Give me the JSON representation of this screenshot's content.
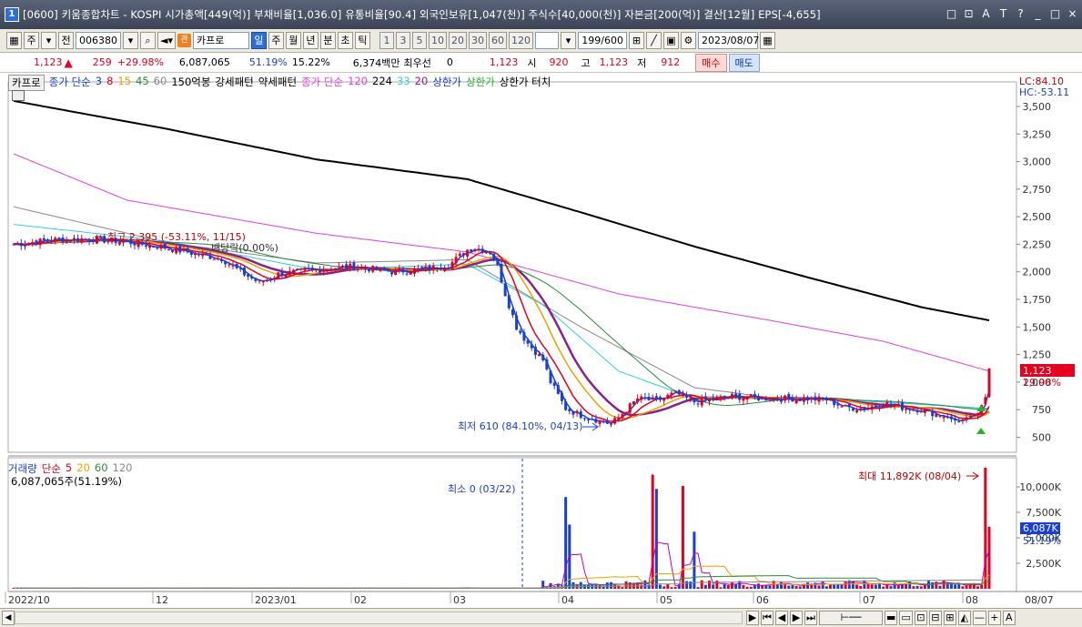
{
  "window": {
    "number": "1",
    "title": "[0600] 키움종합차트 - KOSPI 시가총액[449(억)] 부채비율[1,036.0] 유통비율[90.4] 외국인보유[1,047(천)] 주식수[40,000(천)] 자본금[200(억)] 결산[12월] EPS[-4,655]",
    "icons": [
      "□",
      "⊡",
      "A",
      "T",
      "?",
      "_",
      "□",
      "×"
    ]
  },
  "toolbar": {
    "main_label": "주",
    "prev_label": "전",
    "code": "006380",
    "search_icon": "search-icon",
    "stock_name": "카프로",
    "periods": [
      "일",
      "주",
      "월",
      "년",
      "분",
      "초",
      "틱"
    ],
    "active_period": "일",
    "minute_intervals": [
      "1",
      "3",
      "5",
      "10",
      "20",
      "30",
      "60",
      "120"
    ],
    "count": "199/600",
    "date": "2023/08/07"
  },
  "price": {
    "current": "1,123",
    "change": "259",
    "change_pct": "+29.98%",
    "volume": "6,087,065",
    "volume_ratio": "51.19%",
    "rate": "15.22%",
    "amount": "6,374백만",
    "pref_label": "최우선",
    "pref_value": "0",
    "bid": "1,123",
    "open_label": "시",
    "open": "920",
    "high_label": "고",
    "high": "1,123",
    "low_label": "저",
    "low": "912",
    "buy_label": "매수",
    "sell_label": "매도"
  },
  "legend": {
    "stock": "카프로",
    "ma_title": "종가 단순",
    "ma_periods": [
      "3",
      "8",
      "15",
      "45",
      "60"
    ],
    "pattern1": "150억봉",
    "pattern2": "강세패턴",
    "pattern3": "약세패턴",
    "ma2_title": "종가 단순",
    "ma2_periods": [
      "120",
      "224",
      "33",
      "20"
    ],
    "limit_up": "상한가",
    "limit_up2": "상한가",
    "limit_touch": "상한가 터치"
  },
  "volume_legend": {
    "title": "거래량",
    "ma_title": "단순",
    "ma_periods": [
      "5",
      "20",
      "60",
      "120"
    ],
    "value": "6,087,065주(51.19%)"
  },
  "annotations": {
    "high": "최고 2,395 (-53.11%, 11/15)",
    "dividend": "배당락(0.00%)",
    "low": "최저 610 (84.10%, 04/13)",
    "min_volume": "최소 0 (03/22)",
    "max_volume": "최대 11,892K (08/04)",
    "lc": "LC:84.10",
    "hc": "HC:-53.11",
    "price_tag": "1,123",
    "price_pct": "29.98%",
    "volume_tag": "6,087K",
    "volume_pct": "51.19%"
  },
  "axes": {
    "price_ticks": [
      "3,500",
      "3,250",
      "3,000",
      "2,750",
      "2,500",
      "2,250",
      "2,000",
      "1,750",
      "1,500",
      "1,250",
      "1,000",
      "750",
      "500"
    ],
    "volume_ticks": [
      "10,000K",
      "7,500K",
      "5,000K",
      "2,500K"
    ],
    "date_labels": [
      "2022/10",
      "12",
      "2023/01",
      "02",
      "03",
      "04",
      "05",
      "06",
      "07",
      "08"
    ],
    "last_date": "08/07"
  },
  "chart_data": {
    "type": "candlestick",
    "price_ylim": [
      380,
      3640
    ],
    "volume_ylim": [
      0,
      12500000
    ],
    "colors": {
      "up": "#e4001e",
      "down": "#1a3fd6",
      "ma3": "#1a3fd6",
      "ma8": "#e4001e",
      "ma15": "#f0a000",
      "ma45": "#882288",
      "ma60": "#2a8a3a",
      "ma120": "#e040e0",
      "ma224": "#000000",
      "ma33": "#30d0e0"
    },
    "close_anchors": [
      [
        0,
        2250
      ],
      [
        10,
        2290
      ],
      [
        20,
        2300
      ],
      [
        30,
        2270
      ],
      [
        40,
        2220
      ],
      [
        50,
        2150
      ],
      [
        55,
        2120
      ],
      [
        60,
        2000
      ],
      [
        65,
        1900
      ],
      [
        70,
        1980
      ],
      [
        80,
        2020
      ],
      [
        90,
        2050
      ],
      [
        100,
        2000
      ],
      [
        110,
        2030
      ],
      [
        115,
        2060
      ],
      [
        120,
        2200
      ],
      [
        122,
        2220
      ],
      [
        126,
        2180
      ],
      [
        128,
        2050
      ],
      [
        130,
        1800
      ],
      [
        133,
        1500
      ],
      [
        136,
        1350
      ],
      [
        140,
        1200
      ],
      [
        142,
        1000
      ],
      [
        146,
        760
      ],
      [
        150,
        700
      ],
      [
        155,
        650
      ],
      [
        158,
        620
      ],
      [
        160,
        680
      ],
      [
        165,
        850
      ],
      [
        170,
        830
      ],
      [
        175,
        900
      ],
      [
        180,
        820
      ],
      [
        190,
        870
      ],
      [
        200,
        850
      ],
      [
        210,
        850
      ],
      [
        215,
        840
      ],
      [
        220,
        770
      ],
      [
        225,
        760
      ],
      [
        230,
        810
      ],
      [
        235,
        770
      ],
      [
        240,
        750
      ],
      [
        245,
        700
      ],
      [
        250,
        640
      ],
      [
        252,
        680
      ],
      [
        255,
        720
      ],
      [
        257,
        864
      ],
      [
        258,
        1123
      ]
    ],
    "ma224_anchors": [
      [
        0,
        3550
      ],
      [
        40,
        3300
      ],
      [
        80,
        3020
      ],
      [
        120,
        2840
      ],
      [
        150,
        2540
      ],
      [
        180,
        2230
      ],
      [
        210,
        1950
      ],
      [
        240,
        1680
      ],
      [
        258,
        1560
      ]
    ],
    "ma120_anchors": [
      [
        0,
        3070
      ],
      [
        30,
        2650
      ],
      [
        80,
        2350
      ],
      [
        120,
        2180
      ],
      [
        160,
        1800
      ],
      [
        200,
        1560
      ],
      [
        230,
        1370
      ],
      [
        258,
        1100
      ]
    ],
    "ma60_anchors": [
      [
        0,
        2590
      ],
      [
        40,
        2270
      ],
      [
        80,
        2080
      ],
      [
        120,
        2110
      ],
      [
        150,
        1500
      ],
      [
        180,
        950
      ],
      [
        200,
        860
      ],
      [
        230,
        820
      ],
      [
        258,
        760
      ]
    ],
    "ma33_anchors": [
      [
        0,
        2430
      ],
      [
        40,
        2280
      ],
      [
        80,
        2020
      ],
      [
        120,
        2070
      ],
      [
        140,
        1700
      ],
      [
        160,
        1100
      ],
      [
        180,
        850
      ],
      [
        210,
        860
      ],
      [
        258,
        760
      ]
    ],
    "volume_spikes": [
      [
        146,
        9000000
      ],
      [
        147,
        6300000
      ],
      [
        169,
        11200000
      ],
      [
        170,
        9800000
      ],
      [
        177,
        10100000
      ],
      [
        180,
        5600000
      ],
      [
        257,
        11892000
      ],
      [
        258,
        6087065
      ]
    ]
  }
}
